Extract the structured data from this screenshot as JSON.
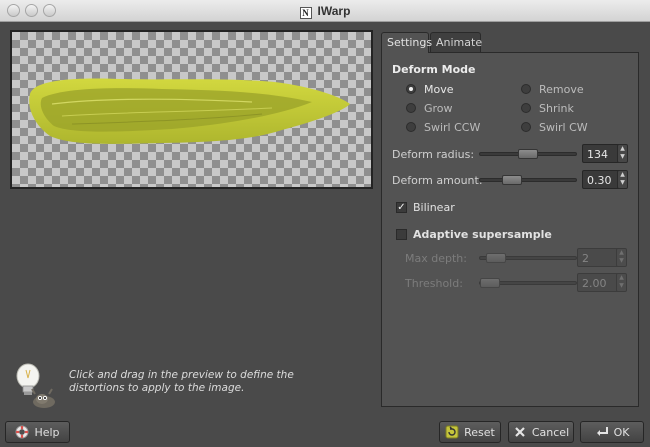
{
  "window": {
    "title": "IWarp"
  },
  "hint": {
    "text": "Click and drag in the preview to define the distortions to apply to the image."
  },
  "tabs": [
    {
      "label": "Settings",
      "active": true
    },
    {
      "label": "Animate",
      "active": false
    }
  ],
  "deform_mode": {
    "title": "Deform Mode",
    "options": [
      {
        "label": "Move",
        "selected": true
      },
      {
        "label": "Remove",
        "selected": false
      },
      {
        "label": "Grow",
        "selected": false
      },
      {
        "label": "Shrink",
        "selected": false
      },
      {
        "label": "Swirl CCW",
        "selected": false
      },
      {
        "label": "Swirl CW",
        "selected": false
      }
    ]
  },
  "deform_radius": {
    "label": "Deform radius:",
    "value": "134"
  },
  "deform_amount": {
    "label": "Deform amount:",
    "value": "0.30"
  },
  "bilinear": {
    "label": "Bilinear",
    "checked": true
  },
  "adaptive": {
    "label": "Adaptive supersample",
    "checked": false,
    "max_depth": {
      "label": "Max depth:",
      "value": "2"
    },
    "threshold": {
      "label": "Threshold:",
      "value": "2.00"
    }
  },
  "buttons": {
    "help": "Help",
    "reset": "Reset",
    "cancel": "Cancel",
    "ok": "OK"
  },
  "colors": {
    "shape_fill": "#c6cc3a",
    "shape_inner": "#9ca42a",
    "panel_bg": "#535353",
    "window_bg": "#4a4a4a"
  }
}
